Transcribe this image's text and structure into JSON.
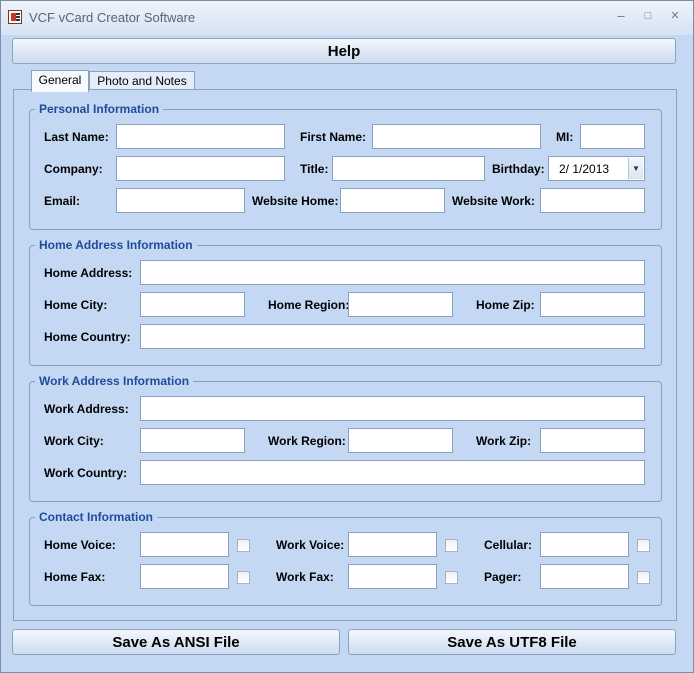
{
  "window": {
    "title": "VCF vCard Creator Software",
    "minimize": "–",
    "maximize": "□",
    "close": "✕"
  },
  "toolbar": {
    "help_label": "Help"
  },
  "tabs": [
    {
      "label": "General"
    },
    {
      "label": "Photo and Notes"
    }
  ],
  "personal": {
    "legend": "Personal Information",
    "last_name": "Last Name:",
    "first_name": "First Name:",
    "mi": "MI:",
    "company": "Company:",
    "title": "Title:",
    "birthday": "Birthday:",
    "birthday_value": "2/  1/2013",
    "email": "Email:",
    "website_home": "Website Home:",
    "website_work": "Website Work:"
  },
  "home": {
    "legend": "Home Address Information",
    "address": "Home Address:",
    "city": "Home City:",
    "region": "Home Region:",
    "zip": "Home Zip:",
    "country": "Home Country:"
  },
  "work": {
    "legend": "Work Address Information",
    "address": "Work Address:",
    "city": "Work City:",
    "region": "Work Region:",
    "zip": "Work Zip:",
    "country": "Work Country:"
  },
  "contact": {
    "legend": "Contact Information",
    "home_voice": "Home Voice:",
    "work_voice": "Work Voice:",
    "cellular": "Cellular:",
    "home_fax": "Home Fax:",
    "work_fax": "Work Fax:",
    "pager": "Pager:"
  },
  "footer": {
    "save_ansi": "Save As ANSI File",
    "save_utf8": "Save As UTF8 File"
  }
}
